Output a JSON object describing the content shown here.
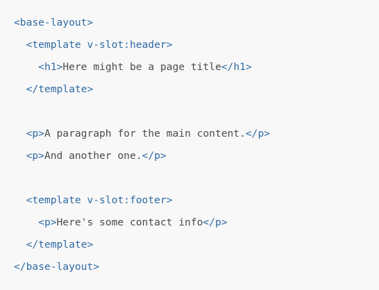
{
  "code": {
    "lines": [
      {
        "indent": "",
        "parts": [
          {
            "kind": "tag",
            "text": "<base-layout>"
          }
        ]
      },
      {
        "indent": "  ",
        "parts": [
          {
            "kind": "tag",
            "text": "<template v-slot:header>"
          }
        ]
      },
      {
        "indent": "    ",
        "parts": [
          {
            "kind": "tag",
            "text": "<h1>"
          },
          {
            "kind": "text",
            "text": "Here might be a page title"
          },
          {
            "kind": "tag",
            "text": "</h1>"
          }
        ]
      },
      {
        "indent": "  ",
        "parts": [
          {
            "kind": "tag",
            "text": "</template>"
          }
        ]
      },
      {
        "indent": "",
        "parts": []
      },
      {
        "indent": "  ",
        "parts": [
          {
            "kind": "tag",
            "text": "<p>"
          },
          {
            "kind": "text",
            "text": "A paragraph for the main content."
          },
          {
            "kind": "tag",
            "text": "</p>"
          }
        ]
      },
      {
        "indent": "  ",
        "parts": [
          {
            "kind": "tag",
            "text": "<p>"
          },
          {
            "kind": "text",
            "text": "And another one."
          },
          {
            "kind": "tag",
            "text": "</p>"
          }
        ]
      },
      {
        "indent": "",
        "parts": []
      },
      {
        "indent": "  ",
        "parts": [
          {
            "kind": "tag",
            "text": "<template v-slot:footer>"
          }
        ]
      },
      {
        "indent": "    ",
        "parts": [
          {
            "kind": "tag",
            "text": "<p>"
          },
          {
            "kind": "text",
            "text": "Here's some contact info"
          },
          {
            "kind": "tag",
            "text": "</p>"
          }
        ]
      },
      {
        "indent": "  ",
        "parts": [
          {
            "kind": "tag",
            "text": "</template>"
          }
        ]
      },
      {
        "indent": "",
        "parts": [
          {
            "kind": "tag",
            "text": "</base-layout>"
          }
        ]
      }
    ]
  },
  "colors": {
    "background": "#f8f8f8",
    "tag": "#2f6aa3",
    "text": "#4b4b4b"
  }
}
